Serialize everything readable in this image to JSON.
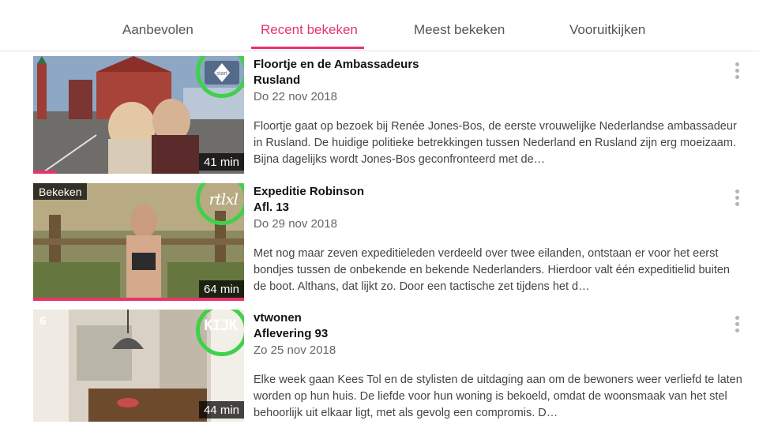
{
  "tabs": [
    {
      "label": "Aanbevolen"
    },
    {
      "label": "Recent bekeken"
    },
    {
      "label": "Meest bekeken"
    },
    {
      "label": "Vooruitkijken"
    }
  ],
  "active_tab": "Recent bekeken",
  "colors": {
    "accent": "#e8336e",
    "highlight_ring": "#3fd14a"
  },
  "items": [
    {
      "title": "Floortje en de Ambassadeurs",
      "subtitle": "Rusland",
      "date": "Do 22 nov 2018",
      "description": "Floortje gaat op bezoek bij Renée Jones-Bos, de eerste vrouwelijke Nederlandse ambassadeur in Rusland. De huidige politieke betrekkingen tussen Nederland en Rusland zijn erg moeizaam. Bijna dagelijks wordt Jones-Bos geconfronteerd met de…",
      "duration": "41 min",
      "channel_logo": "npo-start-icon",
      "channel_text": "start",
      "progress": 0.11
    },
    {
      "title": "Expeditie Robinson",
      "subtitle": "Afl. 13",
      "date": "Do 29 nov 2018",
      "description": "Met nog maar zeven expeditieleden verdeeld over twee eilanden, ontstaan er voor het eerst bondjes tussen de onbekende en bekende Nederlanders. Hierdoor valt één expeditielid buiten de boot. Althans, dat lijkt zo. Door een tactische zet tijdens het d…",
      "duration": "64 min",
      "watched_label": "Bekeken",
      "channel_logo": "rtl-xl-icon",
      "channel_text": "rtlxl",
      "progress": 1.0
    },
    {
      "title": "vtwonen",
      "subtitle": "Aflevering 93",
      "date": "Zo 25 nov 2018",
      "description": "Elke week gaan Kees Tol en de stylisten de uitdaging aan om de bewoners weer verliefd te laten worden op hun huis. De liefde voor hun woning is bekoeld, omdat de woonsmaak van het stel behoorlijk uit elkaar ligt, met als gevolg een compromis. D…",
      "duration": "44 min",
      "channel_logo": "kijk-icon",
      "channel_text": "KIJK",
      "corner_badge": "6",
      "progress": 0
    }
  ]
}
